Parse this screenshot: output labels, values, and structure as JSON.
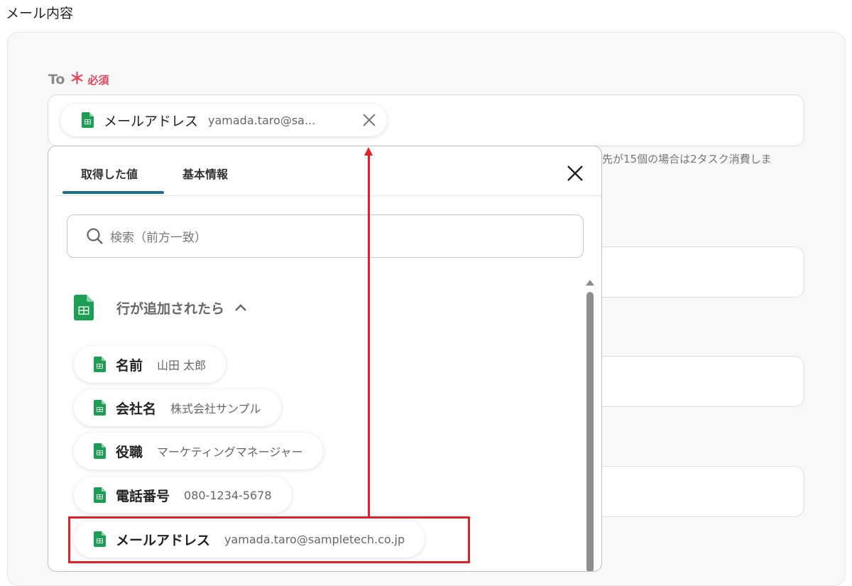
{
  "section_title": "メール内容",
  "to_field": {
    "label": "To",
    "required_star": "＊",
    "required_text": "必須",
    "chip": {
      "label": "メールアドレス",
      "value": "yamada.taro@sa..."
    }
  },
  "hint_text": "先が15個の場合は2タスク消費しま",
  "dropdown": {
    "tabs": [
      {
        "label": "取得した値",
        "active": true
      },
      {
        "label": "基本情報",
        "active": false
      }
    ],
    "search_placeholder": "検索（前方一致）",
    "group": {
      "title": "行が追加されたら",
      "expanded": true
    },
    "items": [
      {
        "label": "名前",
        "value": "山田 太郎"
      },
      {
        "label": "会社名",
        "value": "株式会社サンプル"
      },
      {
        "label": "役職",
        "value": "マーケティングマネージャー"
      },
      {
        "label": "電話番号",
        "value": "080-1234-5678"
      },
      {
        "label": "メールアドレス",
        "value": "yamada.taro@sampletech.co.jp"
      }
    ]
  },
  "colors": {
    "accent": "#1b6e8c",
    "required": "#e2445c",
    "annotation": "#e0202a",
    "sheets_green": "#1e9e54"
  }
}
